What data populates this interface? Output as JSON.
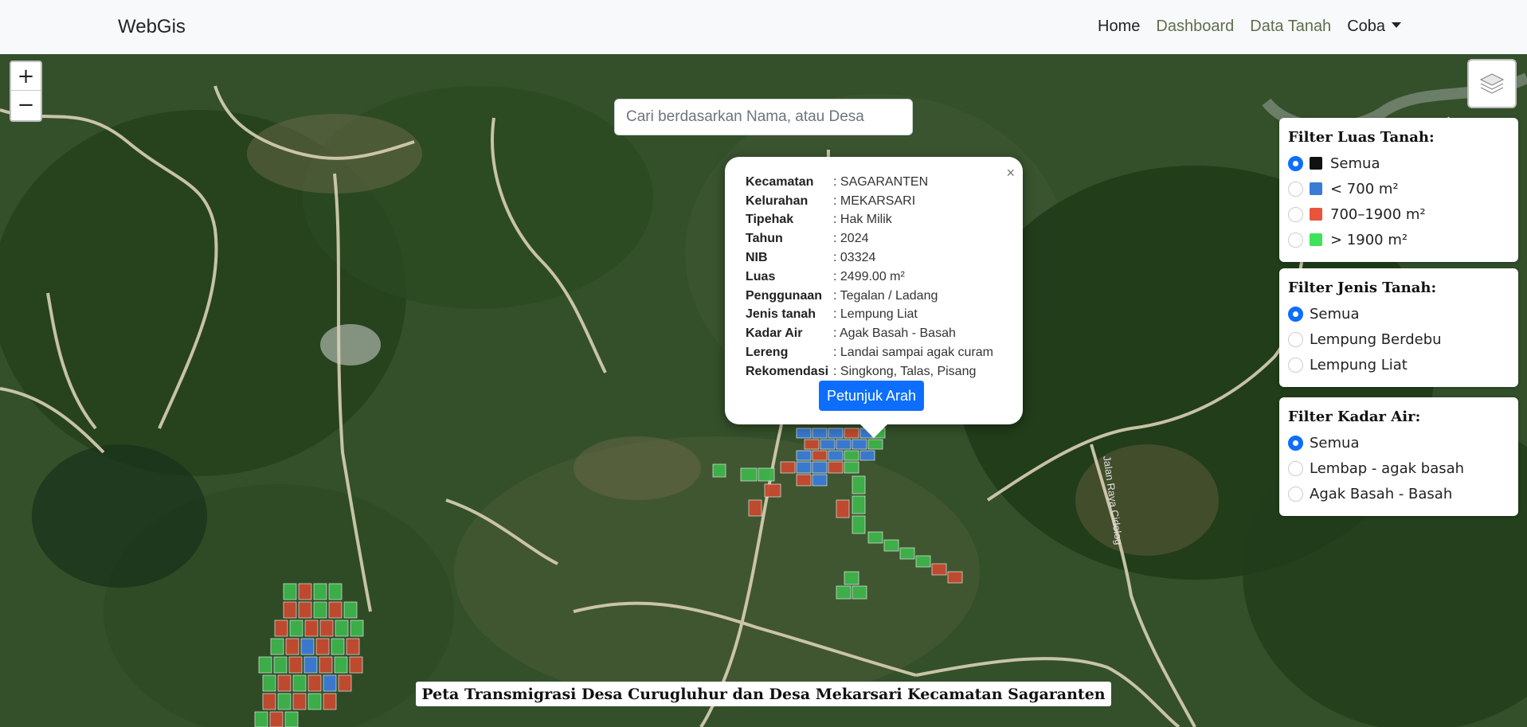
{
  "navbar": {
    "brand": "WebGis",
    "items": [
      {
        "label": "Home"
      },
      {
        "label": "Dashboard"
      },
      {
        "label": "Data Tanah"
      },
      {
        "label": "Coba"
      }
    ]
  },
  "search": {
    "placeholder": "Cari berdasarkan Nama, atau Desa"
  },
  "zoom": {
    "in": "+",
    "out": "−"
  },
  "popup": {
    "rows": [
      {
        "key": "Kecamatan",
        "value": ": SAGARANTEN"
      },
      {
        "key": "Kelurahan",
        "value": ": MEKARSARI"
      },
      {
        "key": "Tipehak",
        "value": ": Hak Milik"
      },
      {
        "key": "Tahun",
        "value": ": 2024"
      },
      {
        "key": "NIB",
        "value": ": 03324"
      },
      {
        "key": "Luas",
        "value": ": 2499.00 m²"
      },
      {
        "key": "Penggunaan",
        "value": ": Tegalan / Ladang"
      },
      {
        "key": "Jenis tanah",
        "value": ": Lempung Liat"
      },
      {
        "key": "Kadar Air",
        "value": ": Agak Basah - Basah"
      },
      {
        "key": "Lereng",
        "value": ": Landai sampai agak curam"
      },
      {
        "key": "Rekomendasi",
        "value": ": Singkong, Talas, Pisang"
      }
    ],
    "button": "Petunjuk Arah",
    "close": "×"
  },
  "filters": {
    "luas": {
      "title": "Filter Luas Tanah:",
      "options": [
        {
          "label": "Semua",
          "color": "#111111",
          "checked": true
        },
        {
          "label": "< 700 m²",
          "color": "#3a7bd5",
          "checked": false
        },
        {
          "label": "700–1900 m²",
          "color": "#e8553a",
          "checked": false
        },
        {
          "label": "> 1900 m²",
          "color": "#3ee35a",
          "checked": false
        }
      ]
    },
    "jenis": {
      "title": "Filter Jenis Tanah:",
      "options": [
        {
          "label": "Semua",
          "checked": true
        },
        {
          "label": "Lempung Berdebu",
          "checked": false
        },
        {
          "label": "Lempung Liat",
          "checked": false
        }
      ]
    },
    "kadar": {
      "title": "Filter Kadar Air:",
      "options": [
        {
          "label": "Semua",
          "checked": true
        },
        {
          "label": "Lembap - agak basah",
          "checked": false
        },
        {
          "label": "Agak Basah - Basah",
          "checked": false
        }
      ]
    }
  },
  "map_label": "Jalan Raya Cidolog",
  "footer_title": "Peta Transmigrasi Desa Curugluhur dan Desa Mekarsari Kecamatan Sagaranten"
}
